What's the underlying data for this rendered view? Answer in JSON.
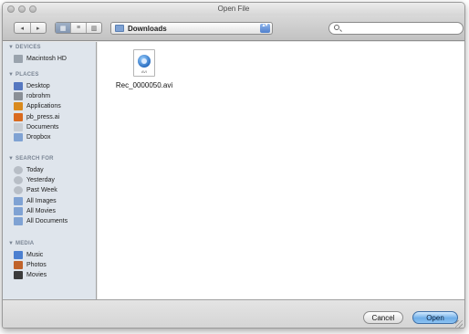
{
  "window": {
    "title": "Open File"
  },
  "toolbar": {
    "nav_back": "◂",
    "nav_forward": "▸",
    "view_icons": "▦",
    "view_list": "≡",
    "view_columns": "▥",
    "path_label": "Downloads",
    "popup_arrows": "▴▾",
    "search_value": "",
    "search_placeholder": ""
  },
  "sidebar": {
    "sections": [
      {
        "label": "▼ DEVICES",
        "items": [
          {
            "label": "Macintosh HD",
            "icon": "hard-drive-icon",
            "color": "#9aa3ad"
          }
        ]
      },
      {
        "label": "▼ PLACES",
        "items": [
          {
            "label": "Desktop",
            "icon": "desktop-icon",
            "color": "#5577c0"
          },
          {
            "label": "robrohm",
            "icon": "home-icon",
            "color": "#8a8f96"
          },
          {
            "label": "Applications",
            "icon": "applications-icon",
            "color": "#d98a1e"
          },
          {
            "label": "pb_press.ai",
            "icon": "illustrator-file-icon",
            "color": "#d96a1f"
          },
          {
            "label": "Documents",
            "icon": "documents-icon",
            "color": "#c7ccd2"
          },
          {
            "label": "Dropbox",
            "icon": "dropbox-folder-icon",
            "color": "#7fa2d3"
          }
        ]
      },
      {
        "label": "▼ SEARCH FOR",
        "items": [
          {
            "label": "Today",
            "icon": "clock-icon",
            "color": "#b8bec6"
          },
          {
            "label": "Yesterday",
            "icon": "clock-icon",
            "color": "#b8bec6"
          },
          {
            "label": "Past Week",
            "icon": "clock-icon",
            "color": "#b8bec6"
          },
          {
            "label": "All Images",
            "icon": "smart-folder-icon",
            "color": "#7fa2d3"
          },
          {
            "label": "All Movies",
            "icon": "smart-folder-icon",
            "color": "#7fa2d3"
          },
          {
            "label": "All Documents",
            "icon": "smart-folder-icon",
            "color": "#7fa2d3"
          }
        ]
      },
      {
        "label": "▼ MEDIA",
        "items": [
          {
            "label": "Music",
            "icon": "music-icon",
            "color": "#4b7fd0"
          },
          {
            "label": "Photos",
            "icon": "photos-icon",
            "color": "#c0632b"
          },
          {
            "label": "Movies",
            "icon": "movies-icon",
            "color": "#3b3b3b"
          }
        ]
      }
    ]
  },
  "files": [
    {
      "name": "Rec_0000050.avi",
      "type_label": "AVI",
      "icon": "quicktime-movie-file-icon"
    }
  ],
  "buttons": {
    "cancel": "Cancel",
    "open": "Open"
  }
}
